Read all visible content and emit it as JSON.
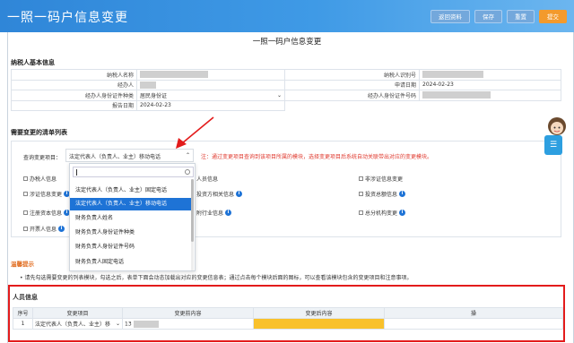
{
  "app": {
    "title": "一照一码户信息变更",
    "buttons": {
      "return": "返回资料",
      "save": "保存",
      "reset": "重置",
      "submit": "提交"
    }
  },
  "form_title": "一照一码户信息变更",
  "basic": {
    "heading": "纳税人基本信息",
    "taxpayer_name_label": "纳税人名称",
    "taxpayer_id_label": "纳税人识别号",
    "handler_label": "经办人",
    "apply_date_label": "申请日期",
    "apply_date": "2024-02-23",
    "handler_idtype_label": "经办人身份证件种类",
    "handler_idtype": "居民身份证",
    "handler_idno_label": "经办人身份证件号码",
    "report_date_label": "报告日期",
    "report_date": "2024-02-23"
  },
  "change": {
    "heading": "需要变更的清单列表",
    "query_label": "查询变更项目：",
    "query_value": "法定代表人（负责人、业主）移动电话",
    "note": "注：通过变更项目查询到该项目所属的模块，选择变更项目后系统自动关联带出对应的变更模块。",
    "checkboxes": [
      {
        "label": "办税人信息",
        "info": false
      },
      {
        "label": "人员信息",
        "info": false
      },
      {
        "label": "非涉证信息变更",
        "info": false
      },
      {
        "label": "涉证信息变更",
        "info": true
      },
      {
        "label": "投资方相关信息",
        "info": true
      },
      {
        "label": "投资总额信息",
        "info": true
      },
      {
        "label": "注册资本信息",
        "info": true
      },
      {
        "label": "附行业信息",
        "info": true
      },
      {
        "label": "总分机构变更",
        "info": true
      },
      {
        "label": "开票人信息",
        "info": true
      }
    ]
  },
  "dropdown": {
    "search_placeholder": "",
    "items": [
      "法定代表人（负责人、业主）固定电话",
      "法定代表人（负责人、业主）移动电话",
      "财务负责人姓名",
      "财务负责人身份证件种类",
      "财务负责人身份证件号码",
      "财务负责人固定电话"
    ],
    "active_index": 1
  },
  "tips": {
    "heading": "温馨提示",
    "text": "• 请先勾选需要变更的列表模块，勾选之后，表单下面会动态加载出对应的变更信息表；通过点击每个模块后面的图标，可以查看该模块包含的变更项目和注意事项。"
  },
  "person": {
    "heading": "人员信息",
    "columns": [
      "序号",
      "变更项目",
      "变更前内容",
      "变更后内容",
      "操"
    ],
    "row": {
      "index": "1",
      "item": "法定代表人（负责人、业主）移",
      "before": "13"
    }
  },
  "colors": {
    "header": "#2f86d8",
    "accent": "#f39a2c",
    "selection": "#1e73d6",
    "warning": "#e31b1b",
    "highlight": "#f9c12b"
  }
}
